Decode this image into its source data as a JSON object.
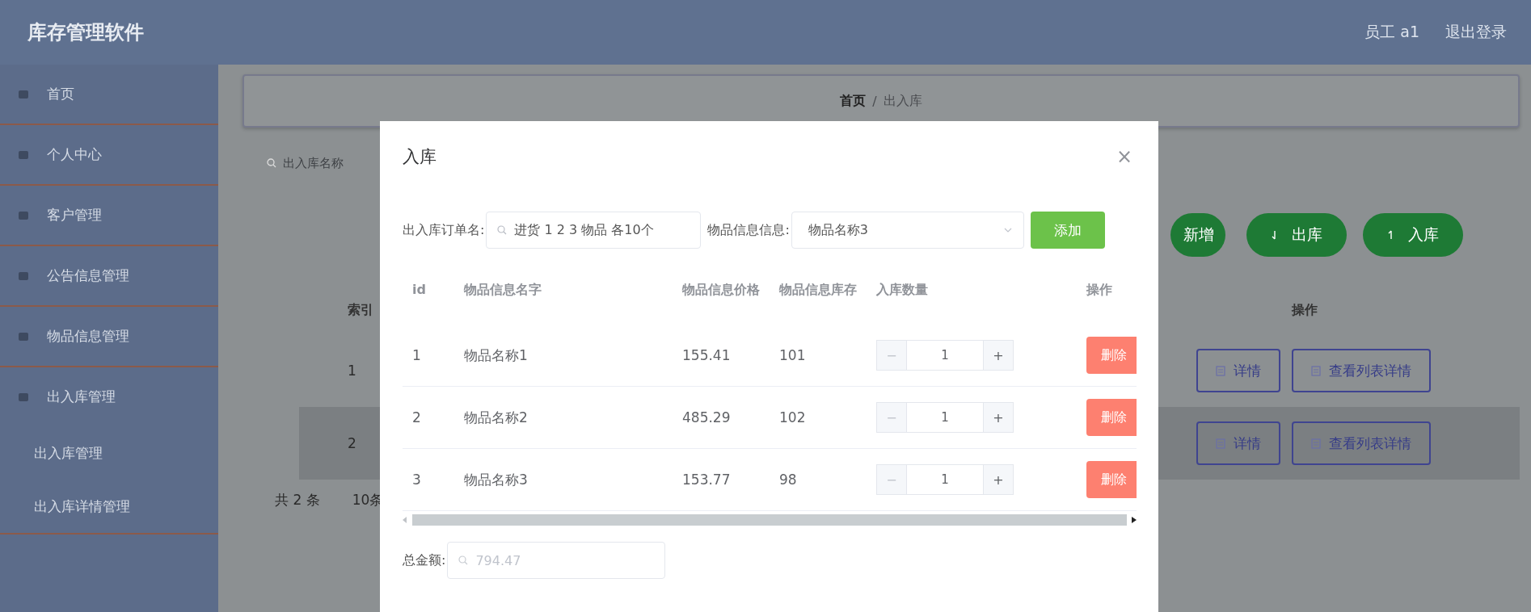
{
  "header": {
    "title": "库存管理软件",
    "user": "员工 a1",
    "logout": "退出登录"
  },
  "sidebar": {
    "items": [
      {
        "label": "首页"
      },
      {
        "label": "个人中心"
      },
      {
        "label": "客户管理"
      },
      {
        "label": "公告信息管理"
      },
      {
        "label": "物品信息管理"
      },
      {
        "label": "出入库管理",
        "children": [
          {
            "label": "出入库管理"
          },
          {
            "label": "出入库详情管理"
          }
        ]
      }
    ]
  },
  "breadcrumb": {
    "separator": "/",
    "items": [
      {
        "label": "首页",
        "current": false
      },
      {
        "label": "出入库",
        "current": true
      }
    ]
  },
  "toolbar": {
    "search_placeholder": "出入库名称",
    "buttons": [
      {
        "label": "新增",
        "kind": "plain"
      },
      {
        "label": "出库",
        "kind": "down"
      },
      {
        "label": "入库",
        "kind": "up"
      }
    ]
  },
  "table": {
    "columns": [
      "索引",
      "操作"
    ],
    "rows": [
      {
        "index": "1",
        "highlighted": false,
        "actions": [
          "详情",
          "查看列表详情"
        ]
      },
      {
        "index": "2",
        "highlighted": true,
        "actions": [
          "详情",
          "查看列表详情"
        ]
      }
    ]
  },
  "pagination": {
    "total": "共 2 条",
    "page_size": "10条"
  },
  "dialog": {
    "title": "入库",
    "close": "×",
    "order_label": "出入库订单名:",
    "order_value": "进货 1 2 3 物品 各10个",
    "item_label": "物品信息信息:",
    "item_value": "物品名称3",
    "add_button": "添加",
    "columns": [
      "id",
      "物品信息名字",
      "物品信息价格",
      "物品信息库存",
      "入库数量",
      "操作"
    ],
    "rows": [
      {
        "id": "1",
        "name": "物品名称1",
        "price": "155.41",
        "stock": "101",
        "qty": "1",
        "action": "删除"
      },
      {
        "id": "2",
        "name": "物品名称2",
        "price": "485.29",
        "stock": "102",
        "qty": "1",
        "action": "删除"
      },
      {
        "id": "3",
        "name": "物品名称3",
        "price": "153.77",
        "stock": "98",
        "qty": "1",
        "action": "删除"
      }
    ],
    "stepper_minus": "−",
    "stepper_plus": "+",
    "total_label": "总金额:",
    "total_value": "794.47"
  }
}
